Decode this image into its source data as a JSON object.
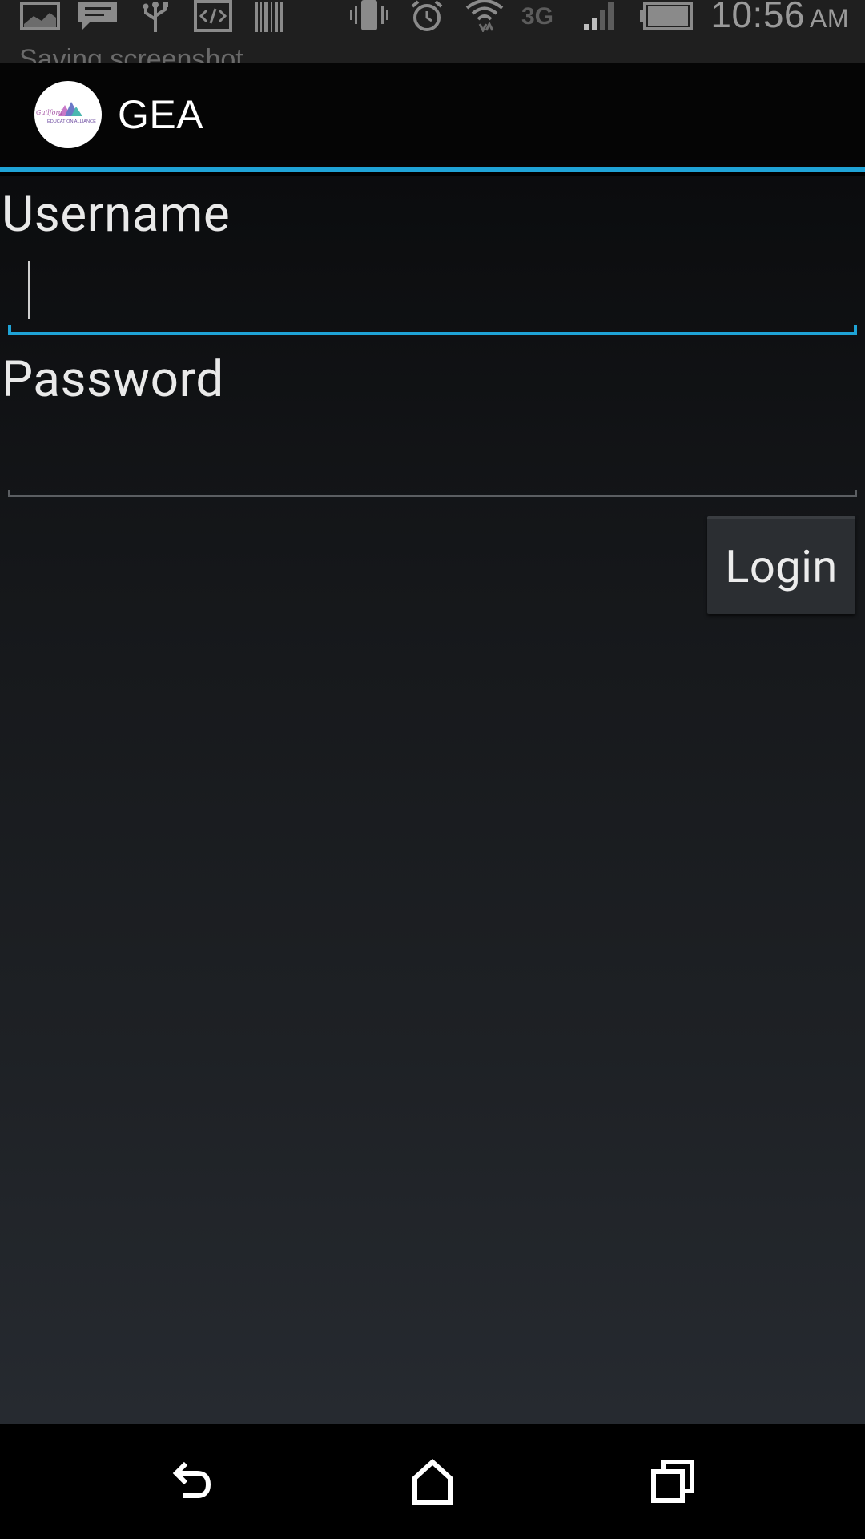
{
  "status_bar": {
    "time": "10:56",
    "ampm": "AM",
    "network": "3G",
    "ghost_notification_text": "Saving screenshot",
    "icons_left": [
      "gallery-icon",
      "chat-icon",
      "usb-icon",
      "code-icon",
      "barcode-icon"
    ],
    "icons_right": [
      "vibrate-icon",
      "alarm-icon",
      "wifi-icon",
      "3g-icon",
      "signal-icon",
      "battery-icon"
    ]
  },
  "action_bar": {
    "title": "GEA",
    "logo_label": "Guilford EDUCATION ALLIANCE",
    "accent_color": "#1fa3d6"
  },
  "form": {
    "username_label": "Username",
    "username_value": "",
    "password_label": "Password",
    "password_value": "",
    "login_label": "Login"
  },
  "nav_bar": {
    "buttons": [
      "back-icon",
      "home-icon",
      "recents-icon"
    ]
  }
}
